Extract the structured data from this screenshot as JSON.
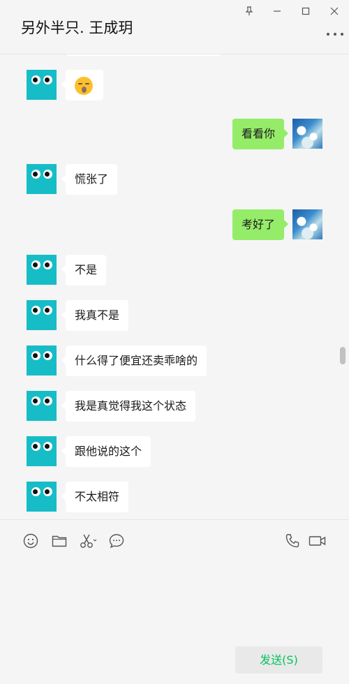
{
  "window": {
    "title": "另外半只. 王成玥",
    "controls": [
      "pin-icon",
      "minimize-icon",
      "maximize-icon",
      "close-icon"
    ],
    "more_icon": "ellipsis-icon"
  },
  "messages": [
    {
      "side": "left",
      "type": "emoji",
      "emoji": "shushing-face-emoji"
    },
    {
      "side": "right",
      "text": "看看你"
    },
    {
      "side": "left",
      "text": "慌张了"
    },
    {
      "side": "right",
      "text": "考好了"
    },
    {
      "side": "left",
      "text": "不是"
    },
    {
      "side": "left",
      "text": "我真不是"
    },
    {
      "side": "left",
      "text": "什么得了便宜还卖乖啥的"
    },
    {
      "side": "left",
      "text": "我是真觉得我这个状态"
    },
    {
      "side": "left",
      "text": "跟他说的这个"
    },
    {
      "side": "left",
      "text": "不太相符"
    }
  ],
  "toolbar": {
    "icons": [
      "emoji-icon",
      "folder-icon",
      "scissors-icon",
      "chat-history-icon",
      "phone-icon",
      "video-call-icon"
    ]
  },
  "composer": {
    "send_label": "发送(S)"
  },
  "colors": {
    "accent": "#07c160",
    "my_bubble": "#95ec69",
    "their_bubble": "#ffffff",
    "bot_avatar": "#17bdc6",
    "background": "#f5f5f5"
  }
}
